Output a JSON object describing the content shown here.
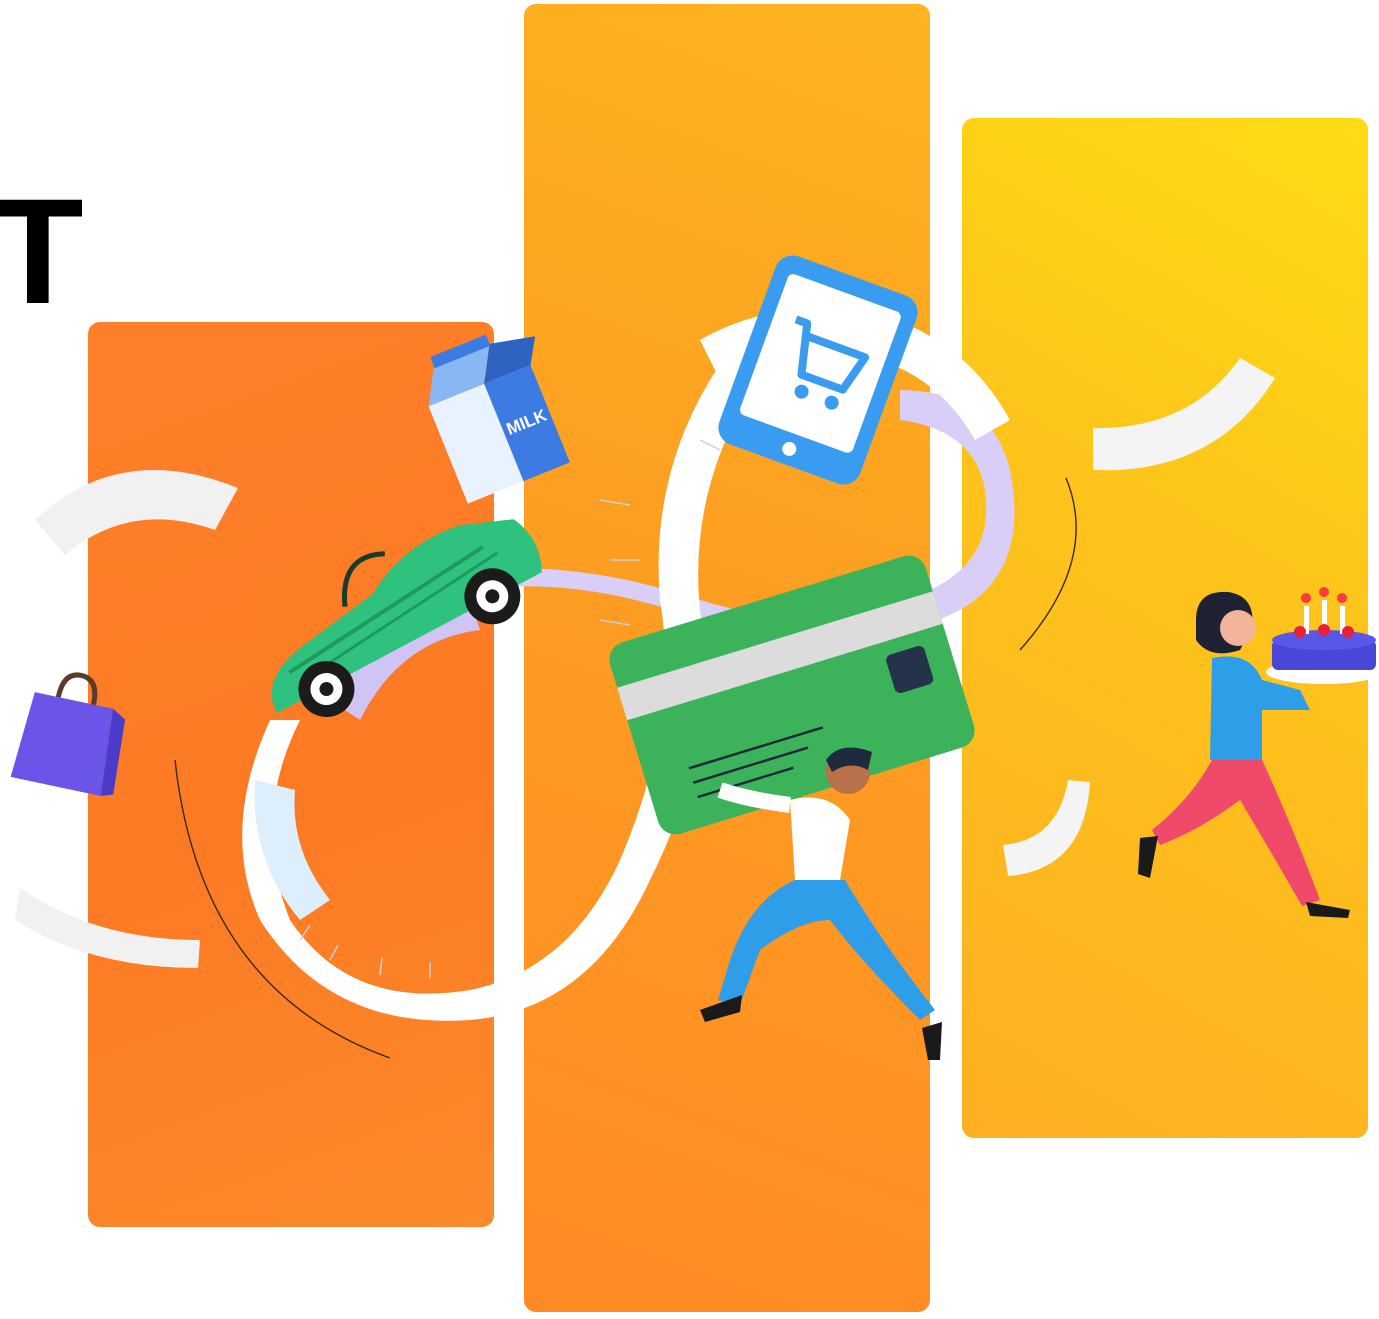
{
  "headline": {
    "text": "T"
  },
  "milk_carton": {
    "label": "MILK"
  },
  "colors": {
    "panel_left": "#fe7f2a",
    "panel_center": "#fda322",
    "panel_right": "#fdc81a",
    "receipt": "#ffffff",
    "ribbon": "#d8cdf6",
    "credit_card": "#3cb35a",
    "car": "#2ec27e",
    "tablet": "#2f8fe8",
    "shopping_bag": "#6a55e8",
    "cake": "#4a47d8"
  },
  "icons": [
    "milk-carton-icon",
    "tablet-cart-icon",
    "sports-car-icon",
    "credit-card-icon",
    "shopping-bag-icon",
    "birthday-cake-icon"
  ],
  "figures": [
    "man-carrying-card",
    "woman-carrying-cake"
  ]
}
